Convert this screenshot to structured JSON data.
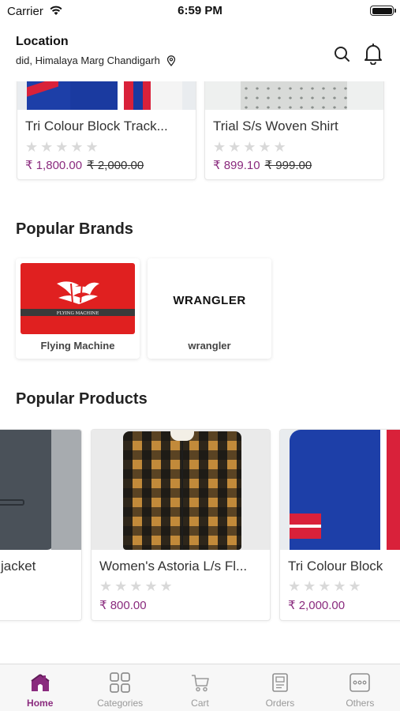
{
  "status_bar": {
    "carrier": "Carrier",
    "time": "6:59 PM"
  },
  "header": {
    "location_label": "Location",
    "address": "did, Himalaya Marg Chandigarh"
  },
  "top_products": [
    {
      "title": "Tri Colour Block Track...",
      "stars": "★★★★★",
      "price": "₹ 1,800.00",
      "mrp": "₹ 2,000.00"
    },
    {
      "title": "Trial S/s Woven Shirt",
      "stars": "★★★★★",
      "price": "₹ 899.10",
      "mrp": "₹ 999.00"
    }
  ],
  "popular_brands": {
    "title": "Popular Brands",
    "items": [
      {
        "name": "Flying Machine",
        "logo_text": "FLYING MACHINE"
      },
      {
        "name": "wrangler",
        "logo_text": "WRANGLER"
      }
    ]
  },
  "popular_products": {
    "title": "Popular Products",
    "items": [
      {
        "title": "jacket",
        "stars": "★★★★★",
        "price": ""
      },
      {
        "title": "Women's Astoria L/s Fl...",
        "stars": "★★★★★",
        "price": "₹ 800.00"
      },
      {
        "title": "Tri Colour Block",
        "stars": "★★★★★",
        "price": "₹ 2,000.00"
      }
    ]
  },
  "tab_bar": {
    "items": [
      {
        "label": "Home",
        "icon": "home-icon",
        "active": true
      },
      {
        "label": "Categories",
        "icon": "categories-icon",
        "active": false
      },
      {
        "label": "Cart",
        "icon": "cart-icon",
        "active": false
      },
      {
        "label": "Orders",
        "icon": "orders-icon",
        "active": false
      },
      {
        "label": "Others",
        "icon": "others-icon",
        "active": false
      }
    ]
  },
  "colors": {
    "accent": "#8a2b7e",
    "brand_red": "#e02020"
  }
}
